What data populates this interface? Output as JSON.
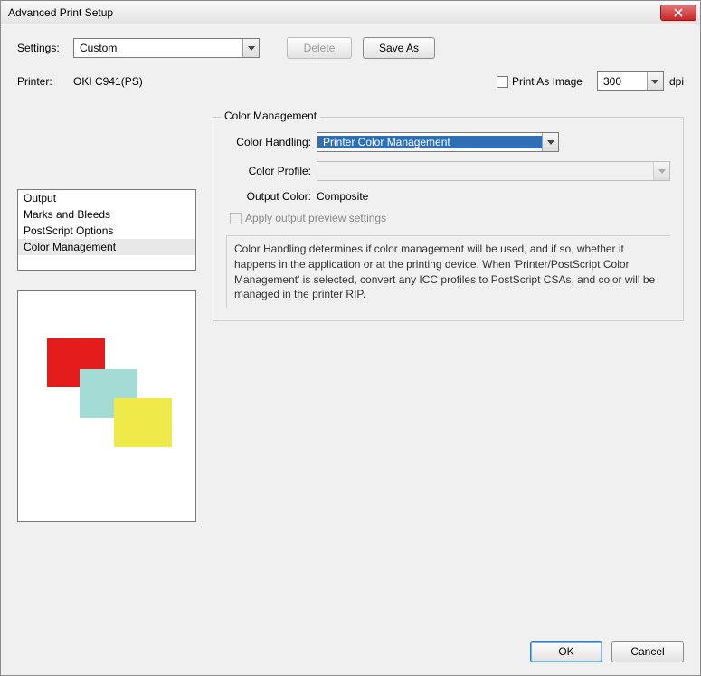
{
  "window": {
    "title": "Advanced Print Setup"
  },
  "top": {
    "settings_label": "Settings:",
    "settings_value": "Custom",
    "delete_label": "Delete",
    "saveas_label": "Save As"
  },
  "printer": {
    "label": "Printer:",
    "name": "OKI C941(PS)",
    "print_as_image_label": "Print As Image",
    "dpi_value": "300",
    "dpi_unit": "dpi"
  },
  "sidebar": {
    "items": [
      {
        "label": "Output"
      },
      {
        "label": "Marks and Bleeds"
      },
      {
        "label": "PostScript Options"
      },
      {
        "label": "Color Management"
      }
    ]
  },
  "panel": {
    "legend": "Color Management",
    "color_handling_label": "Color Handling:",
    "color_handling_value": "Printer Color Management",
    "color_profile_label": "Color Profile:",
    "color_profile_value": "",
    "output_color_label": "Output Color:",
    "output_color_value": "Composite",
    "apply_preview_label": "Apply output preview settings",
    "description": "Color Handling determines if color management will be used, and if so, whether it happens in the application or at the printing device. When 'Printer/PostScript Color Management' is selected, convert any ICC profiles to PostScript CSAs, and color will be managed in the printer RIP."
  },
  "footer": {
    "ok_label": "OK",
    "cancel_label": "Cancel"
  }
}
